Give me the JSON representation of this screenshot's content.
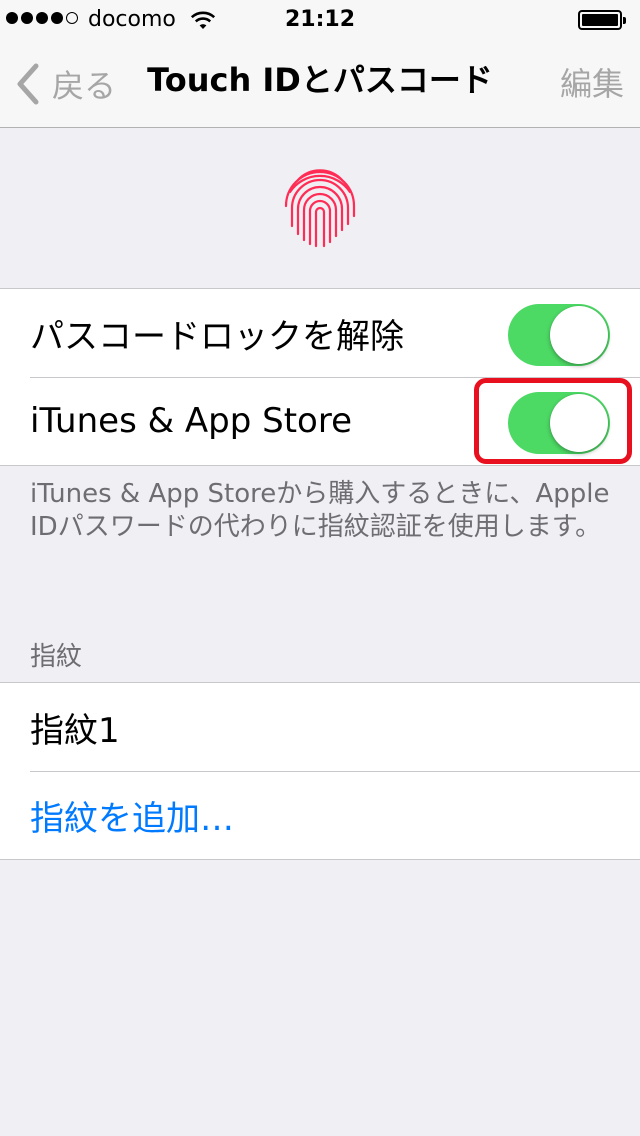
{
  "status_bar": {
    "signal_bars": 4,
    "signal_max": 5,
    "carrier": "docomo",
    "time": "21:12",
    "battery_percent": 100
  },
  "nav": {
    "back_label": "戻る",
    "title": "Touch IDとパスコード",
    "edit_label": "編集"
  },
  "settings": {
    "passcode_unlock": {
      "label": "パスコードロックを解除",
      "on": true
    },
    "itunes_store": {
      "label": "iTunes & App Store",
      "on": true
    },
    "footer": "iTunes & App Storeから購入するときに、Apple IDパスワードの代わりに指紋認証を使用します。"
  },
  "fingerprints": {
    "header": "指紋",
    "items": [
      "指紋1"
    ],
    "add_label": "指紋を追加…"
  },
  "colors": {
    "accent": "#007aff",
    "toggle_on": "#4cd964",
    "fingerprint": "#ff2d55",
    "highlight": "#e8101e",
    "background": "#efeff4"
  },
  "icons": [
    "signal-dots-icon",
    "wifi-icon",
    "battery-icon",
    "back-chevron-icon",
    "touch-id-fingerprint-icon"
  ]
}
